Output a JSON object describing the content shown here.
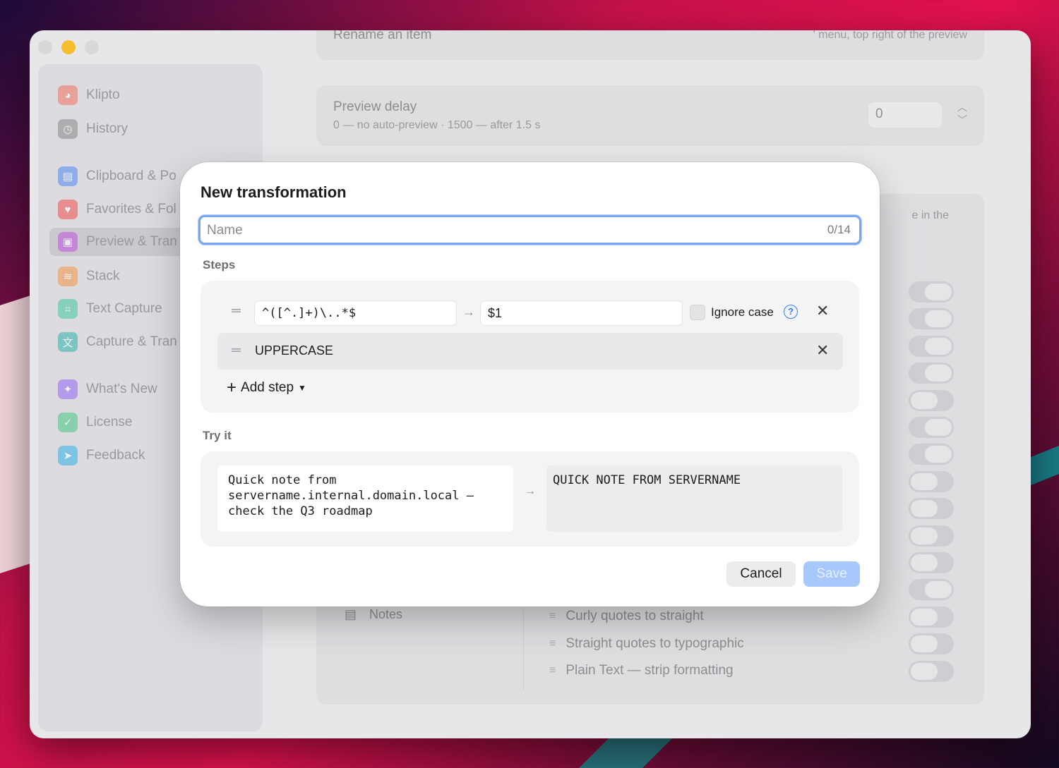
{
  "sidebar": {
    "items": [
      {
        "label": "Klipto",
        "icon": "cat-app-icon",
        "color": "#f07a6a"
      },
      {
        "label": "History",
        "icon": "clock-icon",
        "color": "#8e8d90"
      },
      {
        "label": "Clipboard & Po",
        "icon": "clipboard-icon",
        "color": "#5b8ff0"
      },
      {
        "label": "Favorites & Fol",
        "icon": "heart-icon",
        "color": "#ef5a5a"
      },
      {
        "label": "Preview & Tran",
        "icon": "preview-icon",
        "color": "#c45ae0"
      },
      {
        "label": "Stack",
        "icon": "stack-icon",
        "color": "#f29a52"
      },
      {
        "label": "Text Capture",
        "icon": "text-capture-icon",
        "color": "#4fc9a2"
      },
      {
        "label": "Capture & Tran",
        "icon": "capture-translate-icon",
        "color": "#3db7b0"
      },
      {
        "label": "What's New",
        "icon": "sparkle-icon",
        "color": "#9a6ff2"
      },
      {
        "label": "License",
        "icon": "badge-check-icon",
        "color": "#4fc98a"
      },
      {
        "label": "Feedback",
        "icon": "paper-plane-icon",
        "color": "#3fb4e8"
      }
    ]
  },
  "background": {
    "rename_title": "Rename an item",
    "rename_hint": "' menu, top right of the preview",
    "preview_delay_title": "Preview delay",
    "preview_delay_sub": "0 — no auto-preview · 1500 — after 1.5 s",
    "preview_delay_value": "0",
    "partial_hint": "e in the",
    "notes_label": "Notes",
    "list_items": [
      "Curly quotes to straight",
      "Straight quotes to typographic",
      "Plain Text — strip formatting"
    ]
  },
  "modal": {
    "title": "New transformation",
    "name_placeholder": "Name",
    "name_value": "",
    "name_counter": "0/14",
    "steps_label": "Steps",
    "step1": {
      "pattern": "^([^.]+)\\..*$",
      "replacement": "$1",
      "ignore_case_label": "Ignore case",
      "ignore_case_checked": false
    },
    "step2": {
      "label": "UPPERCASE"
    },
    "add_step_label": "Add step",
    "try_label": "Try it",
    "try_input": "Quick note from\nservername.internal.domain.local —\ncheck the Q3 roadmap",
    "try_output": "QUICK NOTE FROM SERVERNAME",
    "cancel_label": "Cancel",
    "save_label": "Save"
  }
}
